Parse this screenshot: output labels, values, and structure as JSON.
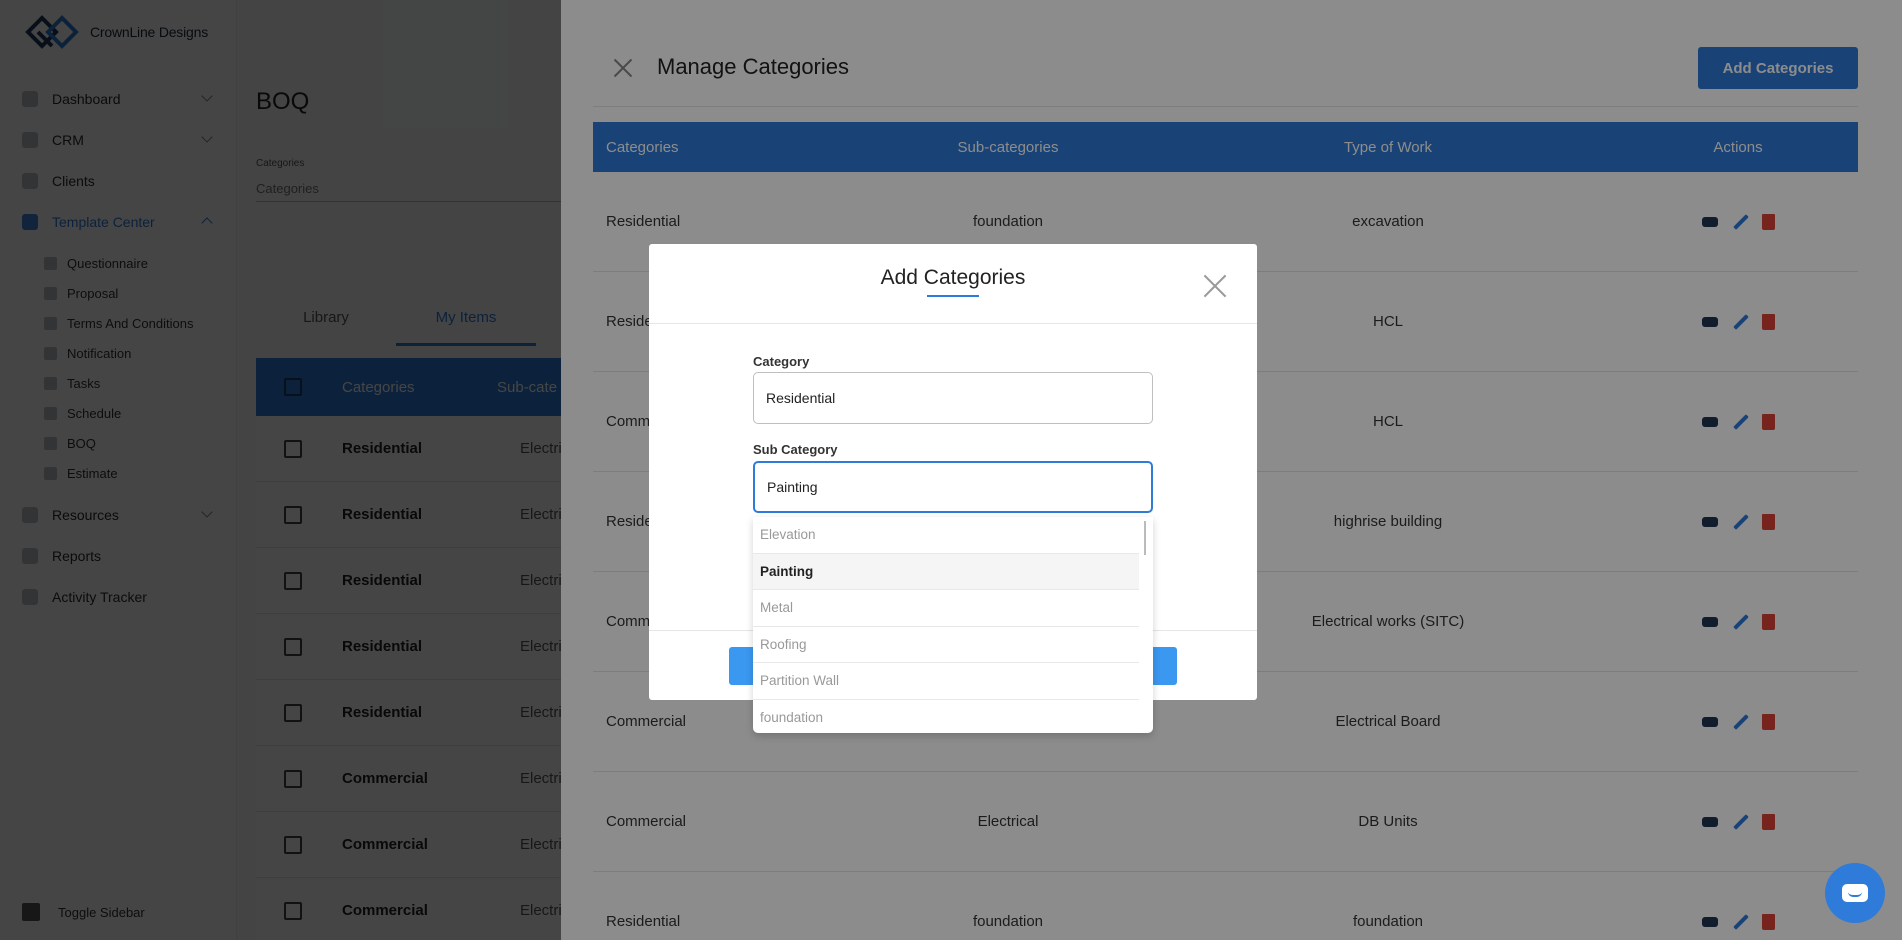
{
  "brand": {
    "name": "CrownLine Designs"
  },
  "sidebar": {
    "items": [
      {
        "label": "Dashboard",
        "icon": "dashboard-icon",
        "expandable": true
      },
      {
        "label": "CRM",
        "icon": "crm-icon",
        "expandable": true
      },
      {
        "label": "Clients",
        "icon": "clients-icon",
        "expandable": false
      },
      {
        "label": "Template Center",
        "icon": "template-icon",
        "expandable": true,
        "active": true
      }
    ],
    "sub_items": [
      {
        "label": "Questionnaire",
        "icon": "questionnaire-icon"
      },
      {
        "label": "Proposal",
        "icon": "proposal-icon"
      },
      {
        "label": "Terms And Conditions",
        "icon": "terms-icon"
      },
      {
        "label": "Notification",
        "icon": "notification-icon"
      },
      {
        "label": "Tasks",
        "icon": "tasks-icon"
      },
      {
        "label": "Schedule",
        "icon": "schedule-icon"
      },
      {
        "label": "BOQ",
        "icon": "boq-icon"
      },
      {
        "label": "Estimate",
        "icon": "estimate-icon"
      }
    ],
    "bottom_items": [
      {
        "label": "Resources",
        "icon": "resources-icon",
        "expandable": true
      },
      {
        "label": "Reports",
        "icon": "reports-icon",
        "expandable": false
      },
      {
        "label": "Activity Tracker",
        "icon": "activity-icon",
        "expandable": false
      }
    ],
    "toggle_label": "Toggle Sidebar"
  },
  "boq": {
    "title": "BOQ",
    "filter_label": "Categories",
    "filter_placeholder": "Categories",
    "tabs": [
      "Library",
      "My Items"
    ],
    "headers": [
      "Categories",
      "Sub-cate"
    ],
    "rows": [
      {
        "category": "Residential",
        "sub": "Electric"
      },
      {
        "category": "Residential",
        "sub": "Electric"
      },
      {
        "category": "Residential",
        "sub": "Electric"
      },
      {
        "category": "Residential",
        "sub": "Electric"
      },
      {
        "category": "Residential",
        "sub": "Electric"
      },
      {
        "category": "Commercial",
        "sub": "Electric"
      },
      {
        "category": "Commercial",
        "sub": "Electric"
      },
      {
        "category": "Commercial",
        "sub": "Electric"
      }
    ]
  },
  "manage": {
    "title": "Manage Categories",
    "add_button": "Add Categories",
    "headers": [
      "Categories",
      "Sub-categories",
      "Type of Work",
      "Actions"
    ],
    "rows": [
      {
        "category": "Residential",
        "sub": "foundation",
        "work": "excavation"
      },
      {
        "category": "Reside",
        "sub": "",
        "work": "HCL"
      },
      {
        "category": "Comm",
        "sub": "",
        "work": "HCL"
      },
      {
        "category": "Reside",
        "sub": "",
        "work": "highrise building"
      },
      {
        "category": "Comm",
        "sub": "",
        "work": "Electrical works (SITC)"
      },
      {
        "category": "Commercial",
        "sub": "",
        "work": "Electrical Board"
      },
      {
        "category": "Commercial",
        "sub": "Electrical",
        "work": "DB Units"
      },
      {
        "category": "Residential",
        "sub": "foundation",
        "work": "foundation"
      }
    ]
  },
  "modal": {
    "title": "Add Categories",
    "category_label": "Category",
    "category_value": "Residential",
    "sub_label": "Sub Category",
    "sub_value": "Painting",
    "options": [
      "Elevation",
      "Painting",
      "Metal",
      "Roofing",
      "Partition Wall",
      "foundation"
    ],
    "selected_option": "Painting"
  },
  "colors": {
    "accent": "#2f7bd9",
    "delete": "#d9423a"
  }
}
